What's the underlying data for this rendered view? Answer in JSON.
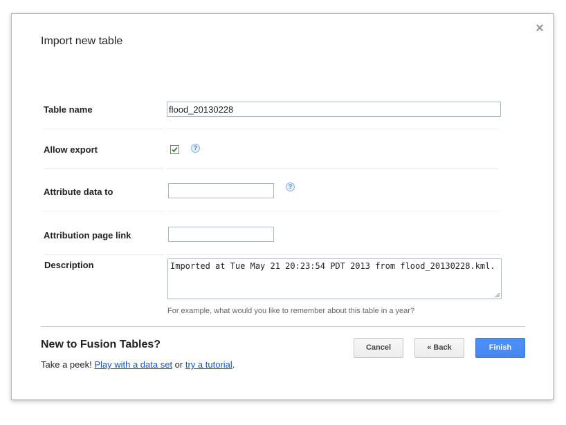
{
  "dialog": {
    "title": "Import new table",
    "close_glyph": "×",
    "close_icon": "close-icon"
  },
  "form": {
    "table_name": {
      "label": "Table name",
      "value": "flood_20130228"
    },
    "allow_export": {
      "label": "Allow export",
      "checked": true,
      "help_glyph": "?"
    },
    "attribute_data_to": {
      "label": "Attribute data to",
      "value": "",
      "help_glyph": "?"
    },
    "attribution_page_link": {
      "label": "Attribution page link",
      "value": ""
    },
    "description": {
      "label": "Description",
      "value": "Imported at Tue May 21 20:23:54 PDT 2013 from flood_20130228.kml.",
      "hint": "For example, what would you like to remember about this table in a year?"
    }
  },
  "footer": {
    "title": "New to Fusion Tables?",
    "text_prefix": "Take a peek! ",
    "link_dataset": "Play with a data set",
    "text_or": " or ",
    "link_tutorial": "try a tutorial",
    "text_suffix": "."
  },
  "buttons": {
    "cancel": "Cancel",
    "back": "« Back",
    "finish": "Finish"
  },
  "colors": {
    "accent": "#4d90fe",
    "link": "#1155cc",
    "checkmark": "#2e8b2e"
  }
}
